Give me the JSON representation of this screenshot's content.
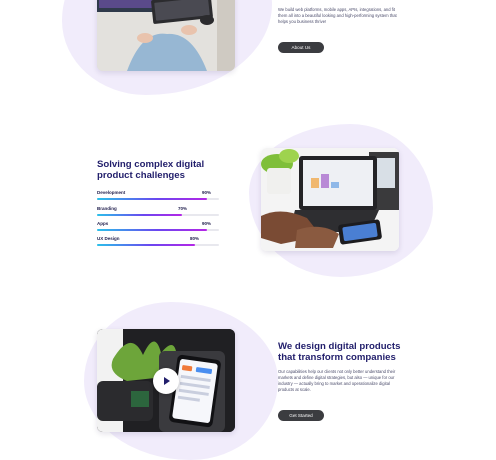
{
  "section_top": {
    "paragraph": "We build web platforms, mobile apps, APIs, integrations, and fit them all into a beautiful looking and high-performing system that helps you business thrive!",
    "button_label": "About Us"
  },
  "section_skills": {
    "heading": "Solving complex digital product challenges",
    "skills": [
      {
        "label": "Development",
        "value_text": "90%",
        "value": 0.9
      },
      {
        "label": "Branding",
        "value_text": "70%",
        "value": 0.7
      },
      {
        "label": "Apps",
        "value_text": "90%",
        "value": 0.9
      },
      {
        "label": "UX Design",
        "value_text": "80%",
        "value": 0.8
      }
    ]
  },
  "section_bottom": {
    "heading": "We design digital products that transform companies",
    "paragraph": "Our capabilities help our clients not only better understand their markets and define digital strategies, but also — unique for our industry — actually bring to market and operationalize digital products at scale.",
    "button_label": "Get Started"
  },
  "colors": {
    "heading": "#211e6b",
    "blob": "#f1ecfb",
    "button": "#3b3c40",
    "gradient_start": "#2bc1ea",
    "gradient_end": "#b526e6"
  }
}
